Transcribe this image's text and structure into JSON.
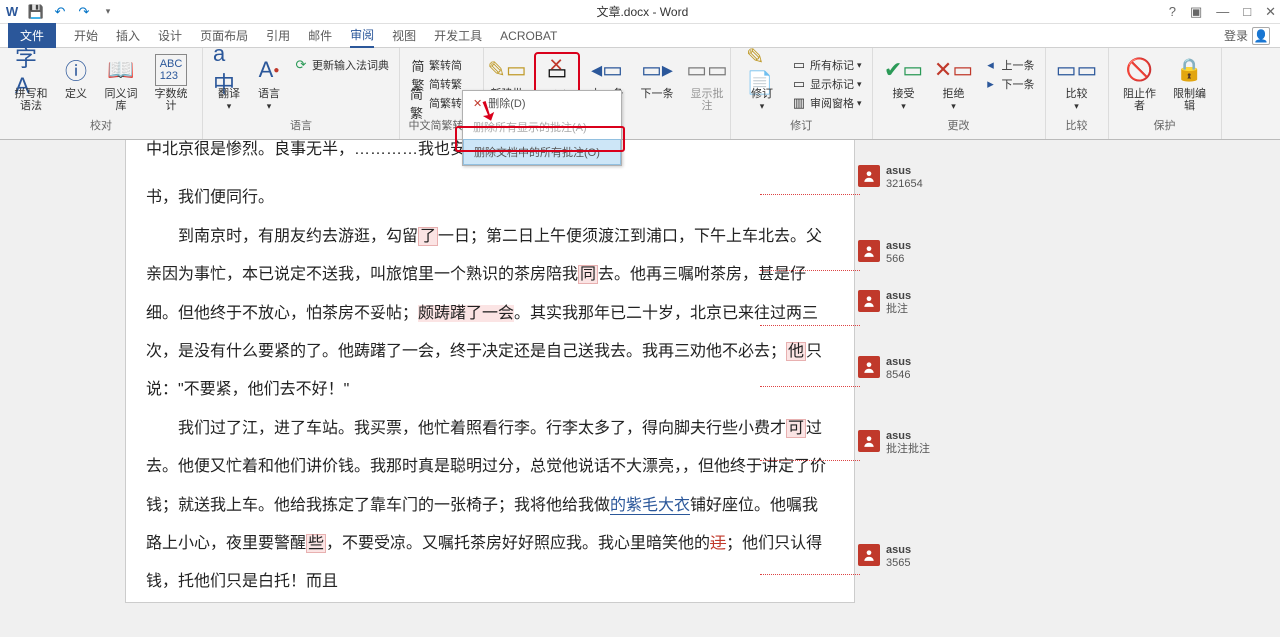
{
  "title": "文章.docx - Word",
  "tabs": {
    "file": "文件",
    "start": "开始",
    "insert": "插入",
    "design": "设计",
    "layout": "页面布局",
    "ref": "引用",
    "mail": "邮件",
    "review": "审阅",
    "view": "视图",
    "dev": "开发工具",
    "acrobat": "ACROBAT"
  },
  "login": "登录",
  "ribbon": {
    "proofing": {
      "spell": "拼写和语法",
      "define": "定义",
      "thesaurus": "同义词库",
      "count": "字数统计",
      "group": "校对"
    },
    "language": {
      "translate": "翻译",
      "lang": "语言",
      "update": "更新输入法词典",
      "group": "语言"
    },
    "convert": {
      "fj": "繁转简",
      "jf": "简转繁",
      "jfz": "简繁转换",
      "group": "中文简繁转换"
    },
    "comments": {
      "new": "新建批注",
      "delete": "删除",
      "prev": "上一条",
      "next": "下一条",
      "show": "显示批注"
    },
    "tracking": {
      "track": "修订",
      "allmarkup": "所有标记",
      "showmarkup": "显示标记",
      "panel": "审阅窗格",
      "group": "修订"
    },
    "changes": {
      "accept": "接受",
      "reject": "拒绝",
      "prev": "上一条",
      "next": "下一条",
      "group": "更改"
    },
    "compare": {
      "compare": "比较",
      "group": "比较"
    },
    "protect": {
      "block": "阻止作者",
      "restrict": "限制编辑",
      "group": "保护"
    }
  },
  "dropdown": {
    "delete": "删除(D)",
    "deleteshown": "删除所有显示的批注(A)",
    "deleteall": "删除文档中的所有批注(O)"
  },
  "document": {
    "p0": "中北京很是惨烈。良事无半，…………我也安向北京念",
    "p0b": "书，我们便同行。",
    "p1_a": "到南京时，有朋友约去游逛，勾留",
    "p1_mark1": "了",
    "p1_b": "一日；第二日上午便须渡江到浦口，下午上车北去。父亲因为事忙，本已说定不送我，叫旅馆里一个熟识的茶房陪我",
    "p1_mark2": "同",
    "p1_c": "去。他再三嘱咐茶房，甚是仔细。但他终于不放心，怕茶房不妥帖；",
    "p1_mark3": "颇踌躇了一会",
    "p1_d": "。其实我那年已二十岁，北京已来往过两三次，是没有什么要紧的了。他踌躇了一会，终于决定还是自己送我去。我再三劝他不必去；",
    "p1_mark4": "他",
    "p1_e": "只说：\"不要紧，他们去不好！\"",
    "p2_a": "我们过了江，进了车站。我买票，他忙着照看行李。行李太多了，得向脚夫行些小费才",
    "p2_mark1": "可",
    "p2_b": "过去。他便又忙着和他们讲价钱。我那时真是聪明过分，总觉他说话不大漂亮，，但他终于讲定了价钱；就送我上车。他给我拣定了靠车门的一张椅子；我将他给我做",
    "p2_underline": "的紫毛大衣",
    "p2_c": "铺好座位。他嘱我路上小心，夜里要警醒",
    "p2_mark2": "些",
    "p2_d": "，不要受凉。又嘱托茶房好好照应我。我心里暗笑他的",
    "p2_strike": "迂",
    "p2_e": "；他们只认得钱，托他们只是白托！而且"
  },
  "comments": [
    {
      "user": "asus",
      "text": "321654"
    },
    {
      "user": "asus",
      "text": "566"
    },
    {
      "user": "asus",
      "text": "批注"
    },
    {
      "user": "asus",
      "text": "8546"
    },
    {
      "user": "asus",
      "text": "批注批注"
    },
    {
      "user": "asus",
      "text": "3565"
    }
  ]
}
